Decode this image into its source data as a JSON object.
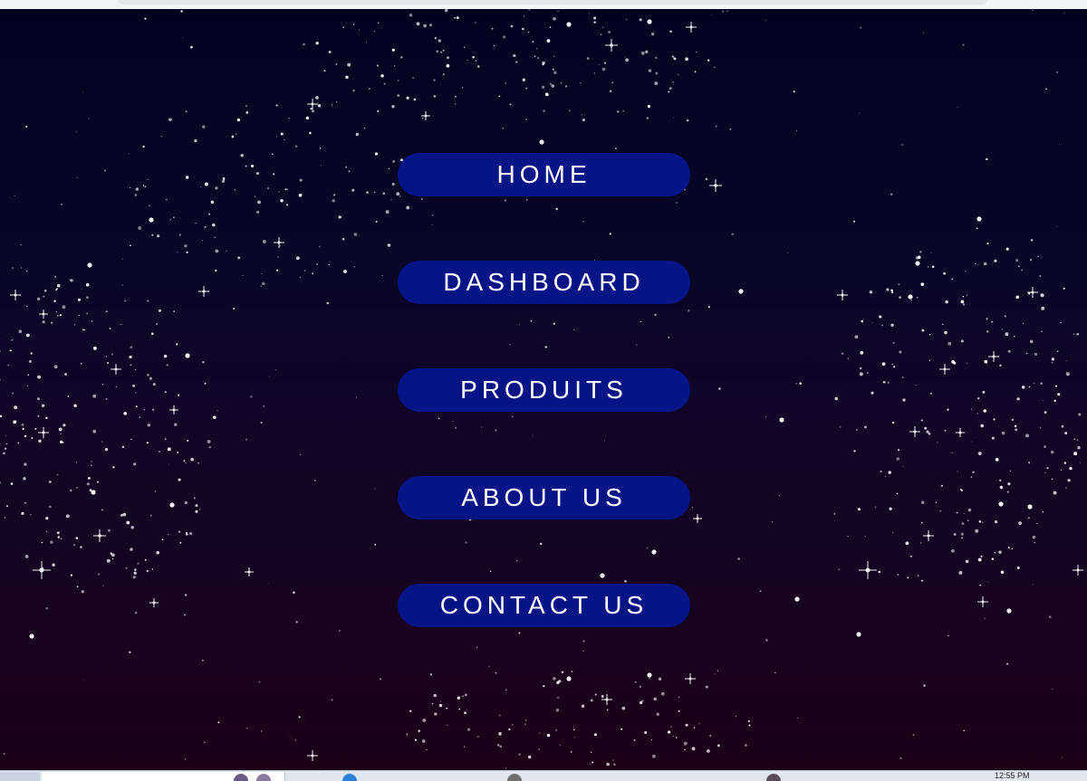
{
  "menu": {
    "items": [
      {
        "label": "HOME"
      },
      {
        "label": "DASHBOARD"
      },
      {
        "label": "PRODUITS"
      },
      {
        "label": "ABOUT US"
      },
      {
        "label": "CONTACT US"
      }
    ]
  },
  "taskbar": {
    "clock": "12:55 PM"
  },
  "colors": {
    "button_background": "#071485",
    "button_text": "#ffffff",
    "sky_top": "#02021f",
    "sky_bottom": "#1c0018"
  },
  "icons": [
    "windows-start-icon",
    "taskbar-app-icon",
    "browser-icon",
    "taskbar-app-icon"
  ]
}
